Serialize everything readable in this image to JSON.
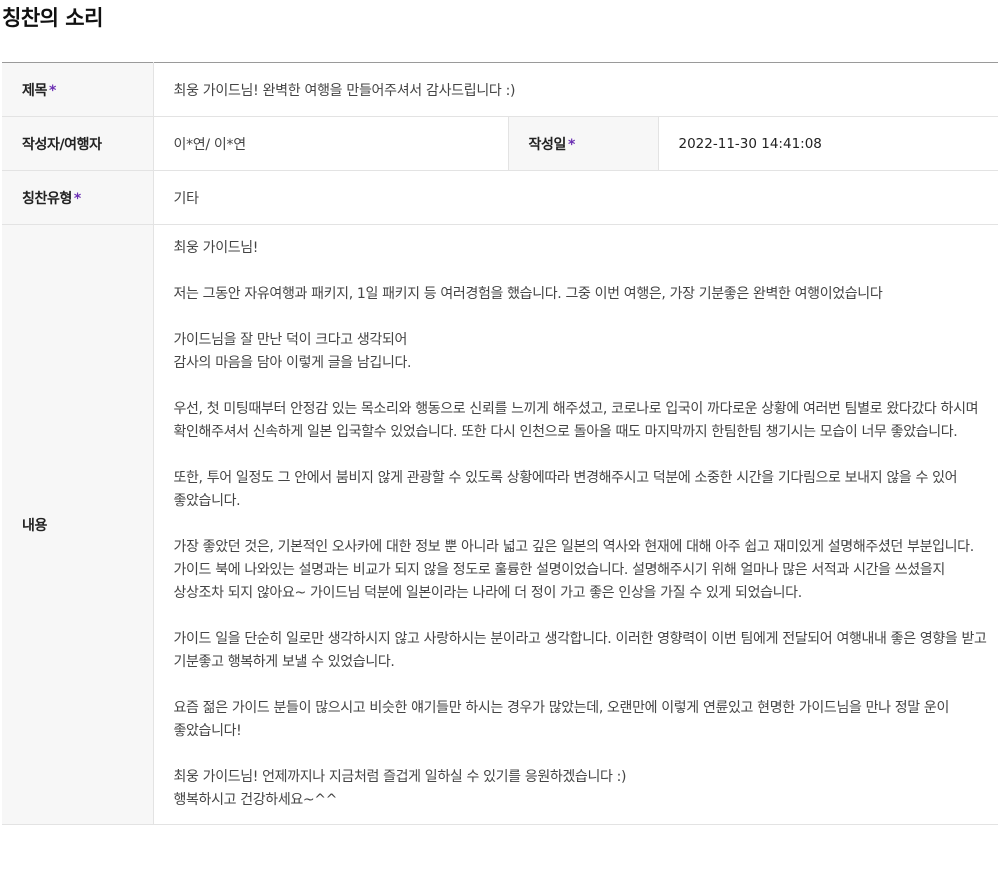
{
  "page": {
    "title": "칭찬의 소리"
  },
  "fields": {
    "subject": {
      "label": "제목",
      "required_mark": "*",
      "value": "최웅 가이드님! 완벽한 여행을 만들어주셔서 감사드립니다 :)"
    },
    "author": {
      "label": "작성자/여행자",
      "value": "이*연/ 이*연"
    },
    "date": {
      "label": "작성일",
      "required_mark": "*",
      "value": "2022-11-30 14:41:08"
    },
    "praise_type": {
      "label": "칭찬유형",
      "required_mark": "*",
      "value": "기타"
    },
    "content": {
      "label": "내용",
      "value": "최웅 가이드님!\n\n저는 그동안 자유여행과 패키지, 1일 패키지 등 여러경험을 했습니다. 그중 이번 여행은, 가장 기분좋은 완벽한 여행이었습니다\n\n가이드님을 잘 만난 덕이 크다고 생각되어\n감사의 마음을 담아 이렇게 글을 남깁니다.\n\n우선, 첫 미팅때부터 안정감 있는 목소리와 행동으로 신뢰를 느끼게 해주셨고, 코로나로 입국이 까다로운 상황에 여러번 팀별로 왔다갔다 하시며 확인해주셔서 신속하게 일본 입국할수 있었습니다. 또한 다시 인천으로 돌아올 때도 마지막까지 한팀한팀 챙기시는 모습이 너무 좋았습니다.\n\n또한, 투어 일정도 그 안에서 붐비지 않게 관광할 수 있도록 상황에따라 변경해주시고 덕분에 소중한 시간을 기다림으로 보내지 않을 수 있어 좋았습니다.\n\n가장 좋았던 것은, 기본적인 오사카에 대한 정보 뿐 아니라 넓고 깊은 일본의 역사와 현재에 대해 아주 쉽고 재미있게 설명해주셨던 부분입니다. 가이드 북에 나와있는 설명과는 비교가 되지 않을 정도로 훌륭한 설명이었습니다. 설명해주시기 위해 얼마나 많은 서적과 시간을 쓰셨을지 상상조차 되지 않아요~ 가이드님 덕분에 일본이라는 나라에 더 정이 가고 좋은 인상을 가질 수 있게 되었습니다.\n\n가이드 일을 단순히 일로만 생각하시지 않고 사랑하시는 분이라고 생각합니다. 이러한 영향력이 이번 팀에게 전달되어 여행내내 좋은 영향을 받고 기분좋고 행복하게 보낼 수 있었습니다.\n\n요즘 젊은 가이드 분들이 많으시고 비슷한 얘기들만 하시는 경우가 많았는데, 오랜만에 이렇게 연륜있고 현명한 가이드님을 만나 정말 운이 좋았습니다!\n\n최웅 가이드님! 언제까지나 지금처럼 즐겁게 일하실 수 있기를 응원하겠습니다 :)\n행복하시고 건강하세요~^^"
    }
  }
}
